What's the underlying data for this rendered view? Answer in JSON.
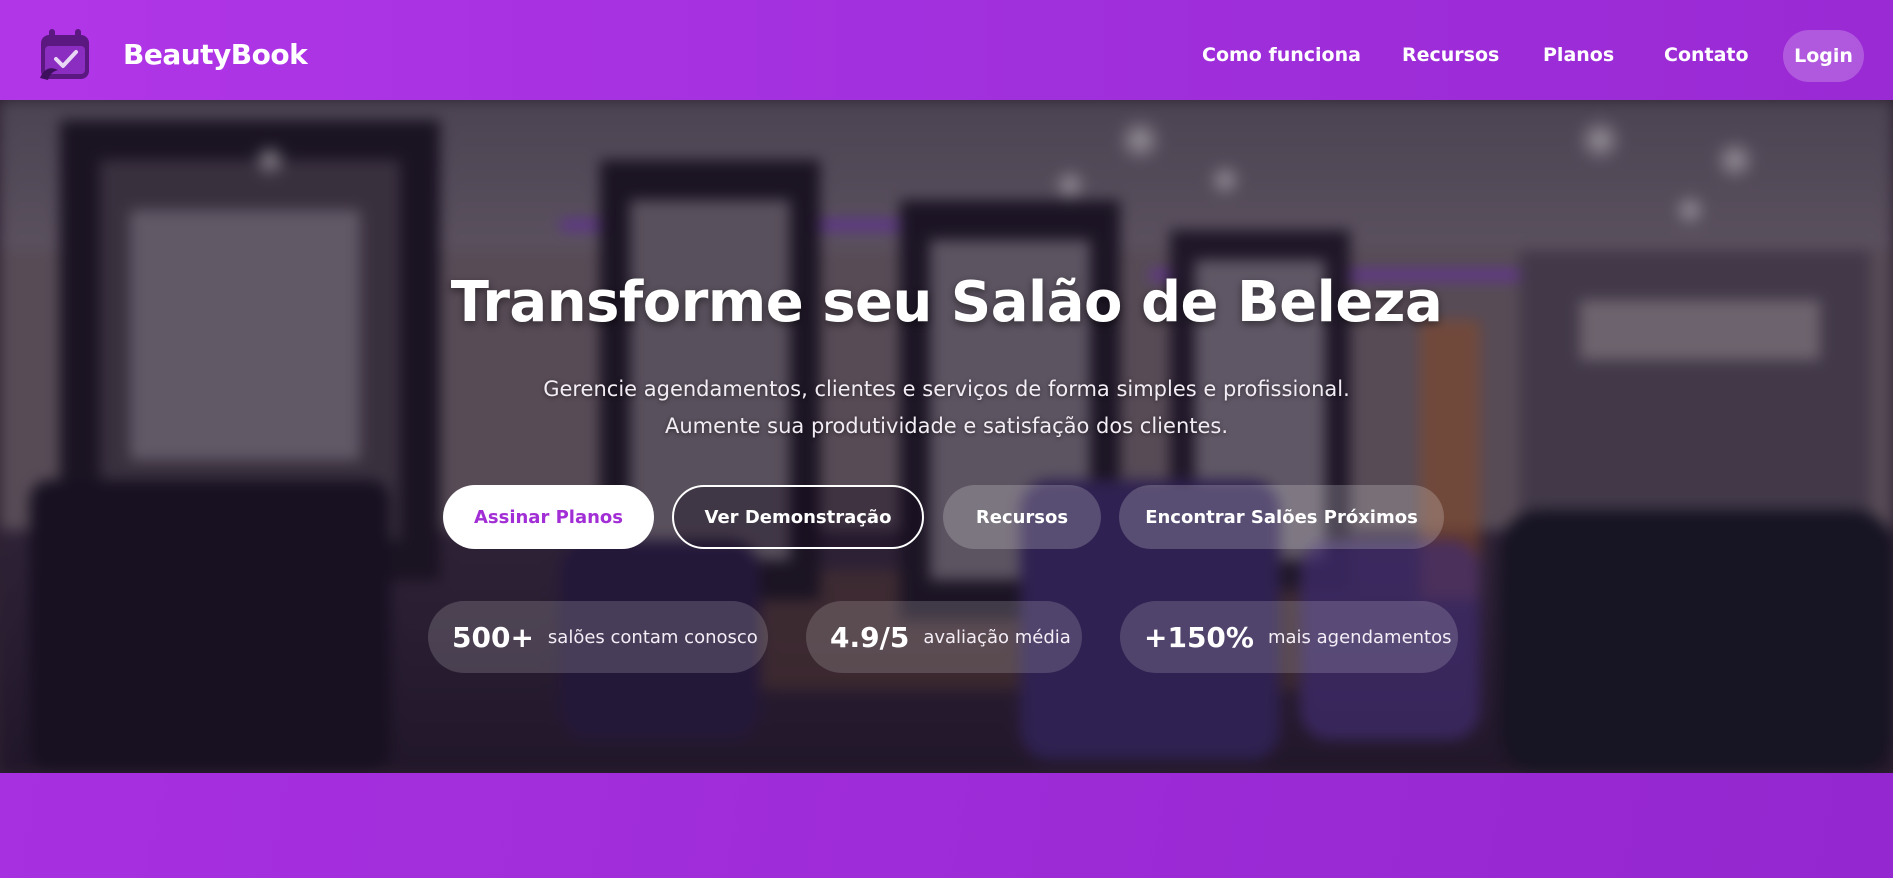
{
  "header": {
    "brand": "BeautyBook",
    "logo_icon": "calendar-check-icon",
    "nav": [
      "Como funciona",
      "Recursos",
      "Planos",
      "Contato"
    ],
    "login": "Login"
  },
  "hero": {
    "title": "Transforme seu Salão de Beleza",
    "subtitle_line1": "Gerencie agendamentos, clientes e serviços de forma simples e profissional.",
    "subtitle_line2": "Aumente sua produtividade e satisfação dos clientes.",
    "buttons": {
      "primary": "Assinar Planos",
      "demo": "Ver Demonstração",
      "features": "Recursos",
      "find": "Encontrar Salões Próximos"
    },
    "stats": [
      {
        "value": "500+",
        "label": "salões contam conosco"
      },
      {
        "value": "4.9/5",
        "label": "avaliação média"
      },
      {
        "value": "+150%",
        "label": "mais agendamentos"
      }
    ]
  },
  "colors": {
    "brand_purple": "#a22ed6",
    "header_start": "#b136e8",
    "header_end": "#9a2ad4"
  }
}
